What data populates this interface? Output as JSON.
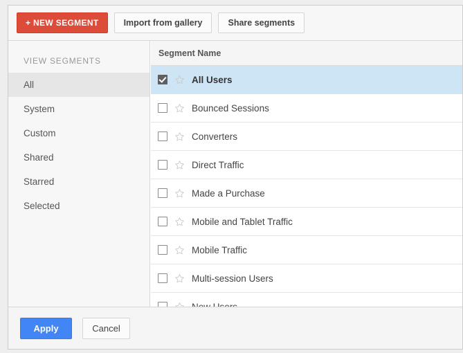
{
  "toolbar": {
    "new_segment_label": "+ NEW SEGMENT",
    "import_label": "Import from gallery",
    "share_label": "Share segments"
  },
  "sidebar": {
    "title": "VIEW SEGMENTS",
    "items": [
      {
        "label": "All",
        "active": true
      },
      {
        "label": "System",
        "active": false
      },
      {
        "label": "Custom",
        "active": false
      },
      {
        "label": "Shared",
        "active": false
      },
      {
        "label": "Starred",
        "active": false
      },
      {
        "label": "Selected",
        "active": false
      }
    ]
  },
  "list": {
    "header": "Segment Name",
    "rows": [
      {
        "name": "All Users",
        "checked": true,
        "starred": false,
        "selected": true
      },
      {
        "name": "Bounced Sessions",
        "checked": false,
        "starred": false,
        "selected": false
      },
      {
        "name": "Converters",
        "checked": false,
        "starred": false,
        "selected": false
      },
      {
        "name": "Direct Traffic",
        "checked": false,
        "starred": false,
        "selected": false
      },
      {
        "name": "Made a Purchase",
        "checked": false,
        "starred": false,
        "selected": false
      },
      {
        "name": "Mobile and Tablet Traffic",
        "checked": false,
        "starred": false,
        "selected": false
      },
      {
        "name": "Mobile Traffic",
        "checked": false,
        "starred": false,
        "selected": false
      },
      {
        "name": "Multi-session Users",
        "checked": false,
        "starred": false,
        "selected": false
      },
      {
        "name": "New Users",
        "checked": false,
        "starred": false,
        "selected": false
      }
    ]
  },
  "footer": {
    "apply_label": "Apply",
    "cancel_label": "Cancel"
  },
  "colors": {
    "new_segment_red": "#dd4b39",
    "apply_blue": "#4285f4",
    "selected_row_blue": "#cee5f5",
    "panel_bg": "#ffffff",
    "sidebar_bg": "#f7f7f7"
  }
}
